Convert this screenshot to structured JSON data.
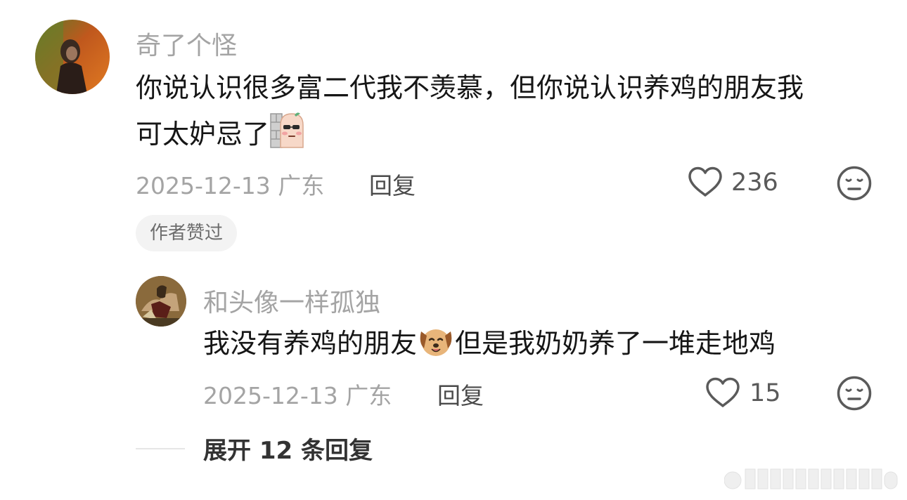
{
  "comment": {
    "username": "奇了个怪",
    "text_line1": "你说认识很多富二代我不羡慕，但你说认识养鸡的朋友我",
    "text_line2": "可太妒忌了",
    "emoji": "peek-wall-emoji",
    "date": "2025-12-13",
    "location": "广东",
    "reply_label": "回复",
    "like_count": "236",
    "author_liked_badge": "作者赞过"
  },
  "reply": {
    "username": "和头像一样孤独",
    "text_part1": "我没有养鸡的朋友",
    "emoji": "dog-face-emoji",
    "text_part2": "但是我奶奶养了一堆走地鸡",
    "date": "2025-12-13",
    "location": "广东",
    "reply_label": "回复",
    "like_count": "15"
  },
  "expand": {
    "label": "展开 12 条回复"
  },
  "colors": {
    "username": "#a4a4a4",
    "text": "#161616",
    "meta": "#a4a4a4",
    "pill_bg": "#f3f3f3"
  }
}
